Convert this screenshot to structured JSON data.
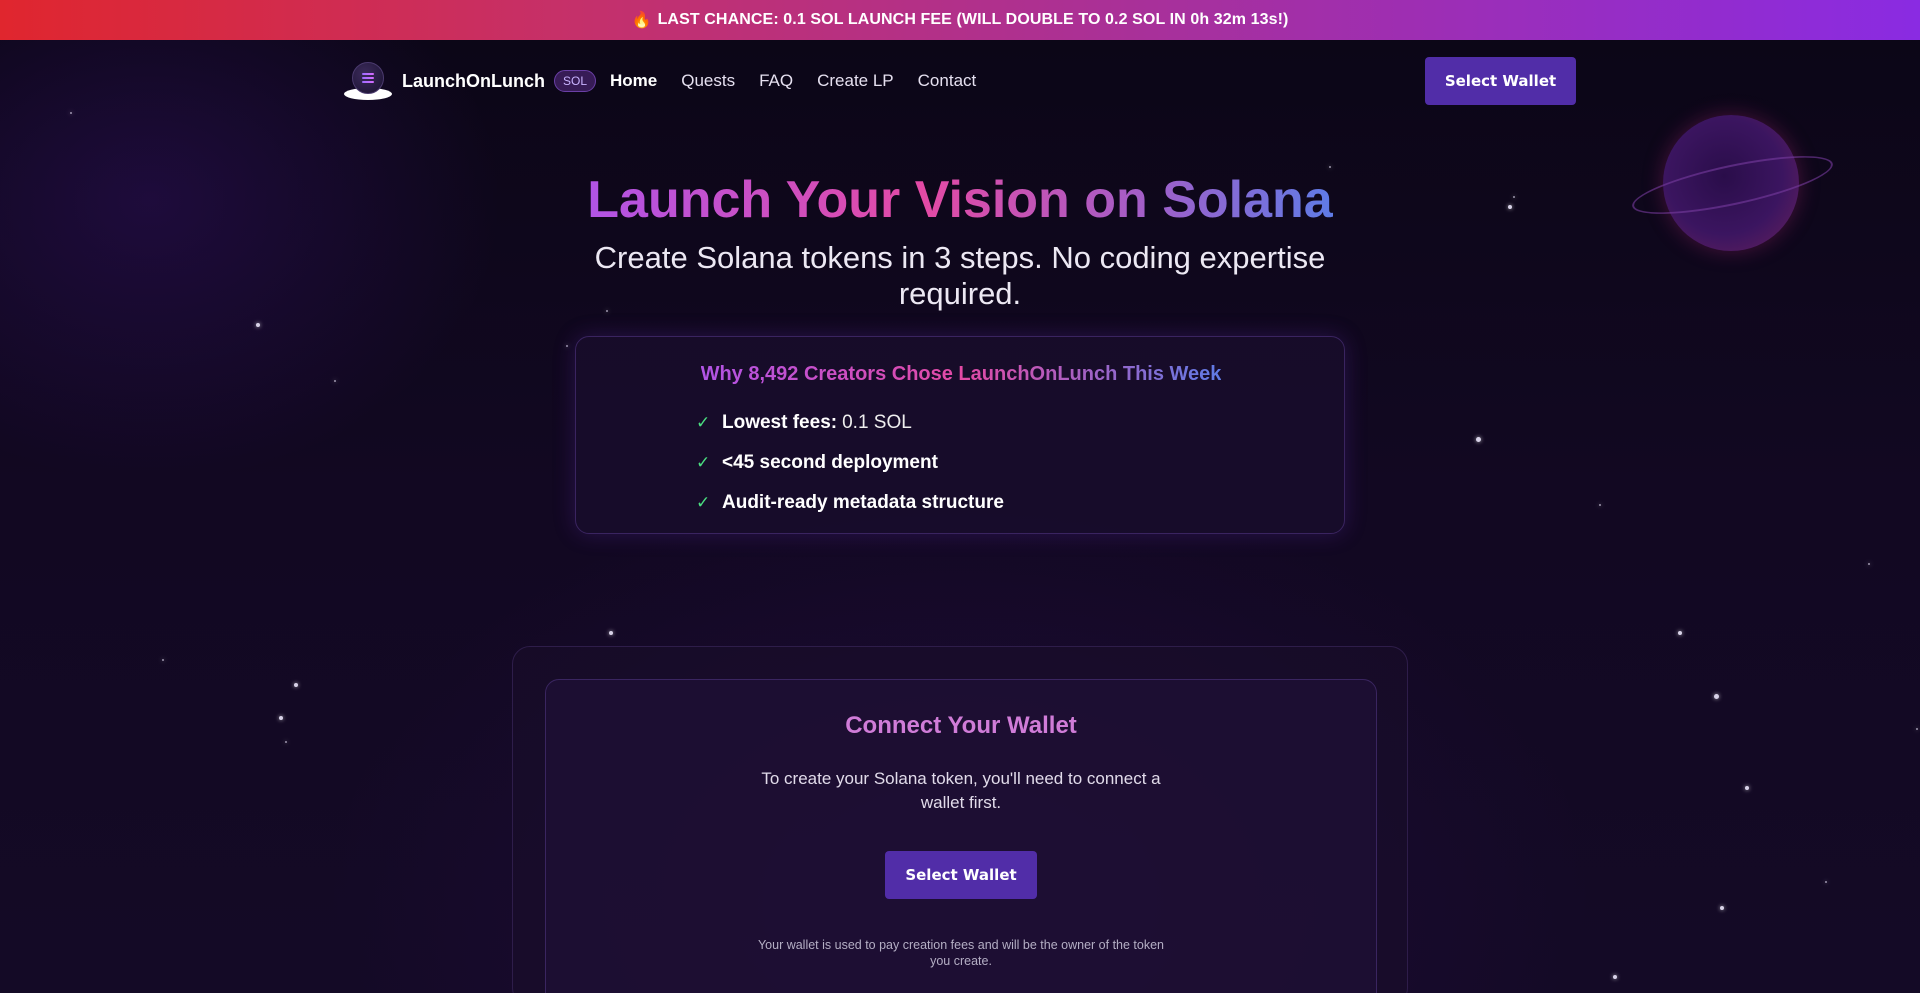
{
  "banner": {
    "icon": "fire-icon",
    "text": "LAST CHANCE: 0.1 SOL LAUNCH FEE (WILL DOUBLE TO 0.2 SOL IN 0h 32m 13s!)"
  },
  "nav": {
    "brand": "LaunchOnLunch",
    "badge": "SOL",
    "links": [
      {
        "label": "Home",
        "active": true
      },
      {
        "label": "Quests"
      },
      {
        "label": "FAQ"
      },
      {
        "label": "Create LP"
      },
      {
        "label": "Contact"
      }
    ],
    "wallet_button": "Select Wallet"
  },
  "hero": {
    "title": "Launch Your Vision on Solana",
    "subtitle": "Create Solana tokens in 3 steps. No coding expertise required."
  },
  "why": {
    "title": "Why 8,492 Creators Chose LaunchOnLunch This Week",
    "items": [
      {
        "bold": "Lowest fees:",
        "value": "0.1 SOL"
      },
      {
        "bold": "<45 second deployment",
        "value": ""
      },
      {
        "bold": "Audit-ready metadata structure",
        "value": ""
      }
    ]
  },
  "connect": {
    "title": "Connect Your Wallet",
    "description": "To create your Solana token, you'll need to connect a wallet first.",
    "button": "Select Wallet",
    "note": "Your wallet is used to pay creation fees and will be the owner of the token you create."
  },
  "colors": {
    "accent": "#512da8",
    "check": "#4ade80",
    "banner_start": "#e0262e",
    "banner_end": "#8a2be2"
  }
}
